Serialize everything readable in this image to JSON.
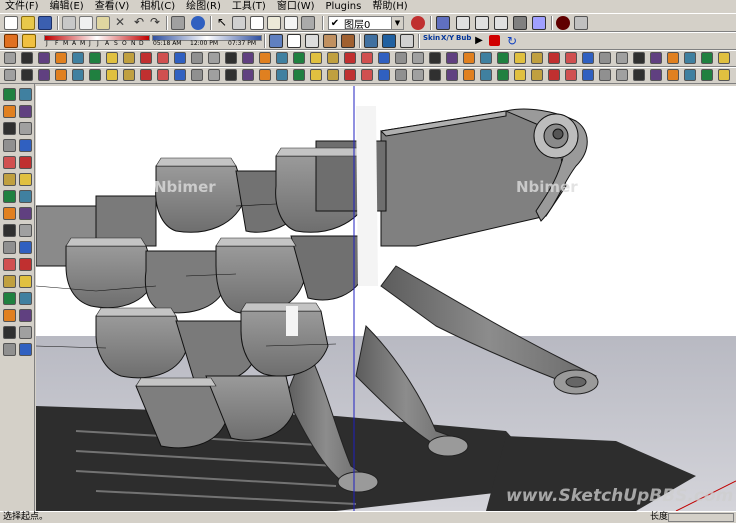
{
  "menu": [
    "文件(F)",
    "编辑(E)",
    "查看(V)",
    "相机(C)",
    "绘图(R)",
    "工具(T)",
    "窗口(W)",
    "Plugins",
    "帮助(H)"
  ],
  "layer": {
    "checked": "✔",
    "value": "图层0",
    "arrow": "▼"
  },
  "shadow": {
    "months": [
      "J",
      "F",
      "M",
      "A",
      "M",
      "J",
      "J",
      "A",
      "S",
      "O",
      "N",
      "D"
    ],
    "times": [
      "05:18 AM",
      "12:00 PM",
      "07:37 PM"
    ]
  },
  "shortcuts": {
    "skin": "Skin",
    "xyz": "X/Y",
    "bub": "Bub"
  },
  "watermarks": {
    "left": "Nbimer",
    "right": "Nbimer",
    "bottom": "www.SketchUpBBS.com"
  },
  "status": {
    "text": "选择起点。",
    "measure_label": "长度",
    "measure_value": ""
  },
  "colors": {
    "chrome": "#d4d0c8",
    "sky": "#ffffff",
    "ground": "#bdbdc4",
    "model": "#8a8a8a",
    "axis_blue": "#2020c0",
    "axis_red": "#c00000"
  }
}
